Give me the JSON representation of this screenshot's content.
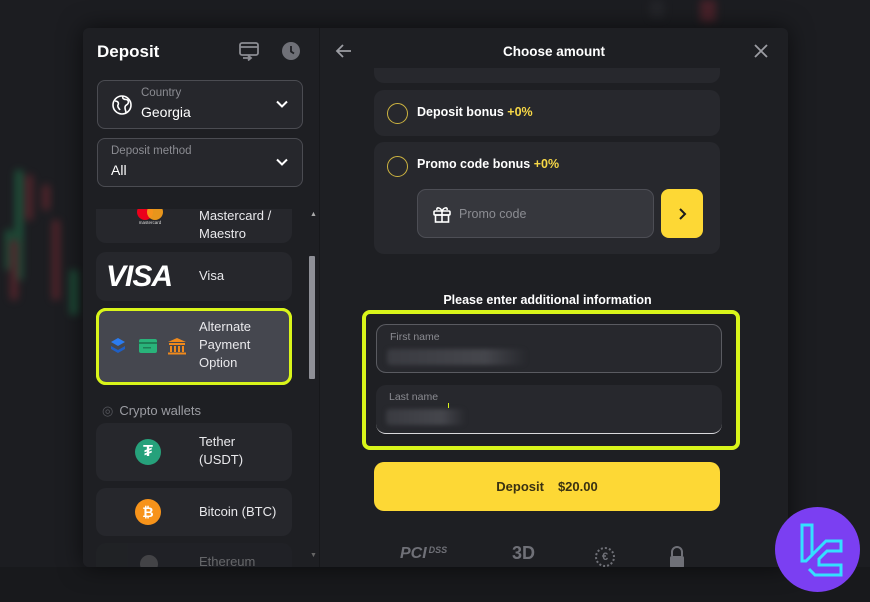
{
  "left_panel": {
    "title": "Deposit",
    "icons": [
      "card-transfer-icon",
      "history-clock-icon"
    ],
    "country": {
      "label": "Country",
      "value": "Georgia",
      "icon": "globe-icon"
    },
    "deposit_method": {
      "label": "Deposit method",
      "value": "All"
    },
    "payment_methods": [
      {
        "label": "Mastercard / Maestro",
        "icon": "mastercard-logo"
      },
      {
        "label": "Visa",
        "icon": "visa-logo",
        "logo_text": "VISA"
      },
      {
        "label": "Alternate Payment Option",
        "icon": "alt-payment-icons",
        "selected": true
      }
    ],
    "crypto_section": {
      "label": "Crypto wallets",
      "icon": "coin-icon"
    },
    "crypto_methods": [
      {
        "label": "Tether (USDT)",
        "icon": "tether-icon",
        "color": "#26a17b"
      },
      {
        "label": "Bitcoin (BTC)",
        "icon": "bitcoin-icon",
        "color": "#f7931a"
      },
      {
        "label": "Ethereum",
        "icon": "ethereum-icon"
      }
    ]
  },
  "right_panel": {
    "title": "Choose amount",
    "back_icon": "arrow-left-icon",
    "close_icon": "close-icon",
    "deposit_bonus": {
      "label": "Deposit bonus",
      "value": "+0%"
    },
    "promo_bonus": {
      "label": "Promo code bonus",
      "value": "+0%"
    },
    "promo_input": {
      "placeholder": "Promo code",
      "value": ""
    },
    "additional_info_title": "Please enter additional information",
    "first_name": {
      "label": "First name",
      "value": "[redacted]"
    },
    "last_name": {
      "label": "Last name",
      "value": "[redacted]"
    },
    "deposit_button": {
      "label": "Deposit",
      "amount": "$20.00"
    },
    "security_logos": [
      "PCI DSS",
      "3D",
      "euro-secure",
      "lock"
    ]
  },
  "colors": {
    "accent_yellow": "#fdd835",
    "highlight_lime": "#d9f51a",
    "bonus_yellow": "#f7d847",
    "badge_purple": "#7b3ff2"
  }
}
